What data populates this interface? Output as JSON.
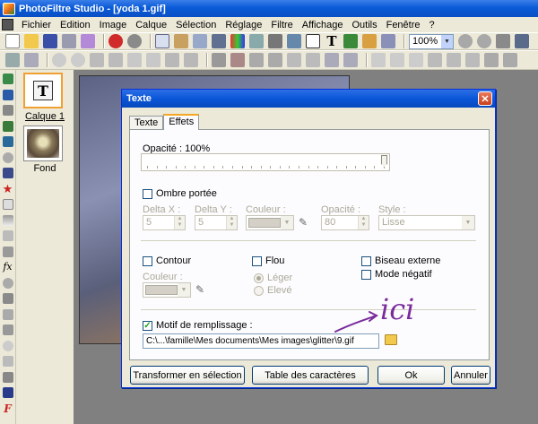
{
  "app": {
    "title": "PhotoFiltre Studio - [yoda 1.gif]"
  },
  "menu": [
    "Fichier",
    "Edition",
    "Image",
    "Calque",
    "Sélection",
    "Réglage",
    "Filtre",
    "Affichage",
    "Outils",
    "Fenêtre",
    "?"
  ],
  "toolbar": {
    "zoom": "100%"
  },
  "layers": [
    {
      "label": "Calque 1",
      "selected": true
    },
    {
      "label": "Fond",
      "selected": false
    }
  ],
  "dialog": {
    "title": "Texte",
    "tabs": [
      {
        "label": "Texte",
        "active": false
      },
      {
        "label": "Effets",
        "active": true
      }
    ],
    "opacity": {
      "label": "Opacité : 100%",
      "value": 100
    },
    "shadow": {
      "label": "Ombre portée",
      "checked": false,
      "delta_x_label": "Delta X :",
      "delta_x": "5",
      "delta_y_label": "Delta Y :",
      "delta_y": "5",
      "color_label": "Couleur :",
      "opacity_label": "Opacité :",
      "opacity": "80",
      "style_label": "Style :",
      "style": "Lisse"
    },
    "contour": {
      "label": "Contour",
      "checked": false,
      "color_label": "Couleur :"
    },
    "blur": {
      "label": "Flou",
      "checked": false,
      "options": [
        "Léger",
        "Elevé"
      ],
      "selected": "Léger"
    },
    "bevel": {
      "label": "Biseau externe",
      "checked": false
    },
    "negative": {
      "label": "Mode négatif",
      "checked": false
    },
    "fill_pattern": {
      "label": "Motif de remplissage :",
      "checked": true,
      "path": "C:\\...\\famille\\Mes documents\\Mes images\\glitter\\9.gif"
    },
    "buttons": {
      "to_selection": "Transformer en sélection",
      "char_table": "Table des caractères",
      "ok": "Ok",
      "cancel": "Annuler"
    }
  },
  "annotation": {
    "text": "ici",
    "color": "#7a2c9c"
  }
}
